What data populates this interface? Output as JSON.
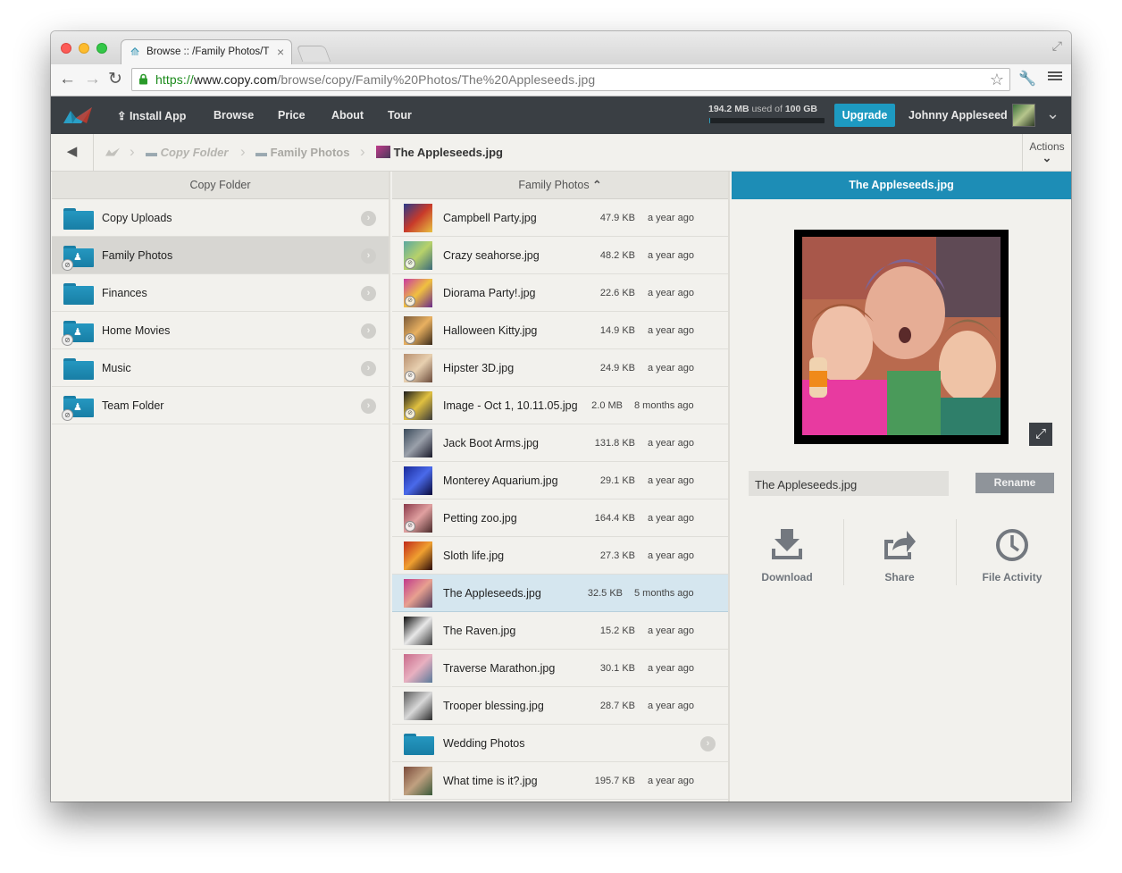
{
  "browser": {
    "tab_title": "Browse :: /Family Photos/T",
    "url_scheme": "https://",
    "url_domain": "www.copy.com",
    "url_path": "/browse/copy/Family%20Photos/The%20Appleseeds.jpg"
  },
  "header": {
    "nav": [
      "Install App",
      "Browse",
      "Price",
      "About",
      "Tour"
    ],
    "storage_used": "194.2 MB",
    "storage_mid": " used of ",
    "storage_total": "100 GB",
    "storage_fraction": 0.0019,
    "upgrade_label": "Upgrade",
    "user_name": "Johnny Appleseed"
  },
  "breadcrumb": {
    "items": [
      "Copy Folder",
      "Family Photos",
      "The Appleseeds.jpg"
    ],
    "actions_label": "Actions"
  },
  "columns": {
    "left_title": "Copy Folder",
    "middle_title": "Family Photos",
    "right_title": "The Appleseeds.jpg"
  },
  "folders": [
    {
      "name": "Copy Uploads",
      "shared": false
    },
    {
      "name": "Family Photos",
      "shared": true,
      "selected": true
    },
    {
      "name": "Finances",
      "shared": false
    },
    {
      "name": "Home Movies",
      "shared": true
    },
    {
      "name": "Music",
      "shared": false
    },
    {
      "name": "Team Folder",
      "shared": true
    }
  ],
  "files": [
    {
      "name": "Campbell Party.jpg",
      "size": "47.9 KB",
      "age": "a year ago",
      "thumb": [
        "#2a3a8a",
        "#c83a2a",
        "#e8c040"
      ]
    },
    {
      "name": "Crazy seahorse.jpg",
      "size": "48.2 KB",
      "age": "a year ago",
      "thumb": [
        "#5aa8a0",
        "#b8d26a",
        "#3a6a7a"
      ],
      "shared": true
    },
    {
      "name": "Diorama Party!.jpg",
      "size": "22.6 KB",
      "age": "a year ago",
      "thumb": [
        "#c83aa0",
        "#f0c040",
        "#6a2a8a"
      ],
      "shared": true
    },
    {
      "name": "Halloween Kitty.jpg",
      "size": "14.9 KB",
      "age": "a year ago",
      "thumb": [
        "#7a5a3a",
        "#e8b060",
        "#3a2a1a"
      ],
      "shared": true
    },
    {
      "name": "Hipster 3D.jpg",
      "size": "24.9 KB",
      "age": "a year ago",
      "thumb": [
        "#b89070",
        "#e8d0b0",
        "#6a4a3a"
      ],
      "shared": true
    },
    {
      "name": "Image - Oct 1, 10.11.05.jpg",
      "size": "2.0 MB",
      "age": "8 months ago",
      "thumb": [
        "#1a1a1a",
        "#e0c040",
        "#3a3a3a"
      ],
      "shared": true
    },
    {
      "name": "Jack Boot Arms.jpg",
      "size": "131.8 KB",
      "age": "a year ago",
      "thumb": [
        "#3a4a5a",
        "#9aa0aa",
        "#1a1a2a"
      ]
    },
    {
      "name": "Monterey Aquarium.jpg",
      "size": "29.1 KB",
      "age": "a year ago",
      "thumb": [
        "#1a2a9a",
        "#4a6aea",
        "#0a0a3a"
      ]
    },
    {
      "name": "Petting zoo.jpg",
      "size": "164.4 KB",
      "age": "a year ago",
      "thumb": [
        "#8a3a4a",
        "#e0a0a0",
        "#4a2a2a"
      ],
      "shared": true
    },
    {
      "name": "Sloth life.jpg",
      "size": "27.3 KB",
      "age": "a year ago",
      "thumb": [
        "#c02a1a",
        "#f0a030",
        "#2a0a0a"
      ]
    },
    {
      "name": "The Appleseeds.jpg",
      "size": "32.5 KB",
      "age": "5 months ago",
      "thumb": [
        "#c03a8a",
        "#e8a090",
        "#4a3a5a"
      ],
      "selected": true
    },
    {
      "name": "The Raven.jpg",
      "size": "15.2 KB",
      "age": "a year ago",
      "thumb": [
        "#0a0a0a",
        "#e8e8e8",
        "#3a3a3a"
      ]
    },
    {
      "name": "Traverse Marathon.jpg",
      "size": "30.1 KB",
      "age": "a year ago",
      "thumb": [
        "#c86a8a",
        "#e8b0c0",
        "#5a7a9a"
      ]
    },
    {
      "name": "Trooper blessing.jpg",
      "size": "28.7 KB",
      "age": "a year ago",
      "thumb": [
        "#5a5a5a",
        "#d8d8d8",
        "#2a2a2a"
      ]
    },
    {
      "name": "Wedding Photos",
      "folder": true
    },
    {
      "name": "What time is it?.jpg",
      "size": "195.7 KB",
      "age": "a year ago",
      "thumb": [
        "#7a4a3a",
        "#c0a080",
        "#3a5a3a"
      ]
    }
  ],
  "preview": {
    "file_name": "The Appleseeds.jpg",
    "rename_label": "Rename",
    "actions": [
      "Download",
      "Share",
      "File Activity"
    ]
  }
}
